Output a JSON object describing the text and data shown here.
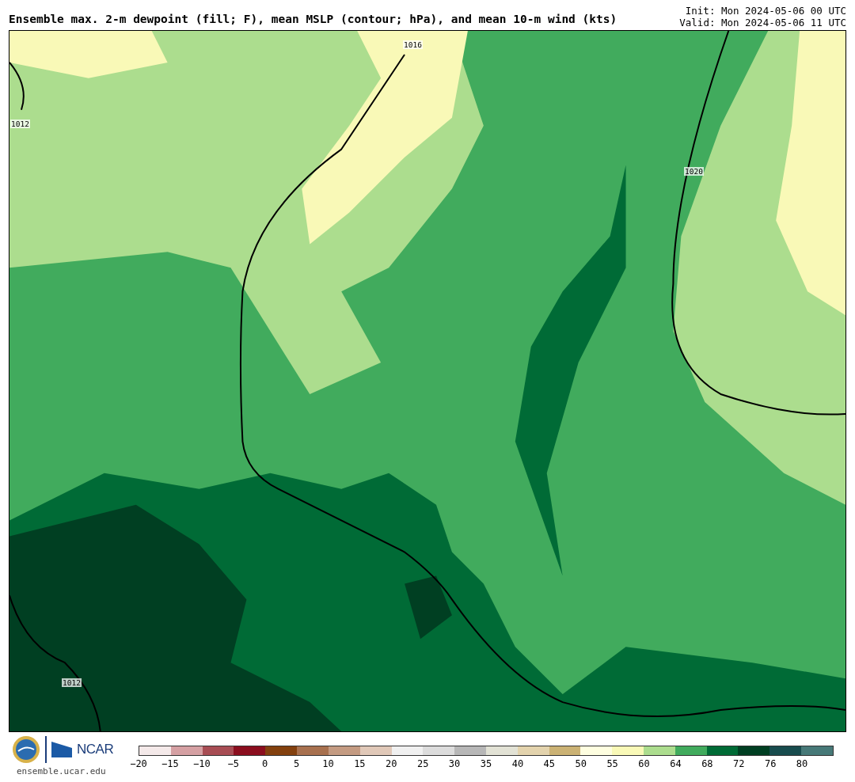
{
  "title": "Ensemble max. 2-m dewpoint (fill; F), mean MSLP (contour; hPa), and mean 10-m wind (kts)",
  "init": "Init: Mon 2024-05-06 00 UTC",
  "valid": "Valid: Mon 2024-05-06 11 UTC",
  "map": {
    "contour_labels": [
      "1016",
      "1012",
      "1020",
      "1012"
    ]
  },
  "footer": {
    "org": "NCAR",
    "site": "ensemble.ucar.edu"
  },
  "colorbar": {
    "segments": [
      {
        "color": "#f4e9e9"
      },
      {
        "color": "#d5a0a3"
      },
      {
        "color": "#a84d54"
      },
      {
        "color": "#8b0e1e"
      },
      {
        "color": "#83400e"
      },
      {
        "color": "#a8714f"
      },
      {
        "color": "#c49b82"
      },
      {
        "color": "#e0c8b8"
      },
      {
        "color": "#f0f0f0"
      },
      {
        "color": "#dcdcdc"
      },
      {
        "color": "#b7b7b7"
      },
      {
        "color": "#e2e2d5"
      },
      {
        "color": "#e3d3ad"
      },
      {
        "color": "#cbb274"
      },
      {
        "color": "#fefee0"
      },
      {
        "color": "#f9f9b7"
      },
      {
        "color": "#acdd8e"
      },
      {
        "color": "#41ab5d"
      },
      {
        "color": "#006b36"
      },
      {
        "color": "#003f22"
      },
      {
        "color": "#184c4e"
      },
      {
        "color": "#477978"
      }
    ],
    "ticks": [
      "−20",
      "−15",
      "−10",
      "−5",
      "0",
      "5",
      "10",
      "15",
      "20",
      "25",
      "30",
      "35",
      "40",
      "45",
      "50",
      "55",
      "60",
      "64",
      "68",
      "72",
      "76",
      "80"
    ]
  }
}
